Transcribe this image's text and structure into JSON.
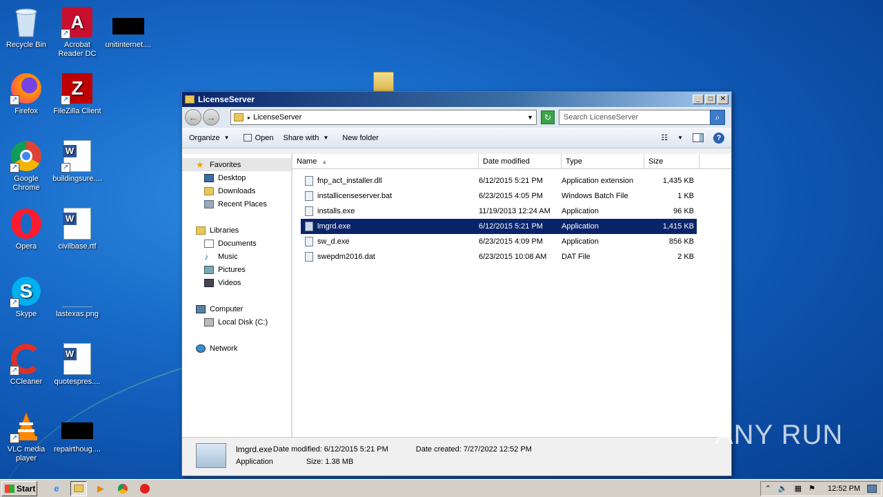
{
  "desktop": {
    "icons": [
      {
        "label": "Recycle Bin",
        "icon": "recycle-bin-icon"
      },
      {
        "label": "Acrobat Reader DC",
        "icon": "acrobat-icon"
      },
      {
        "label": "unitinternet....",
        "icon": "black-thumbnail-icon"
      },
      {
        "label": "Firefox",
        "icon": "firefox-icon"
      },
      {
        "label": "FileZilla Client",
        "icon": "filezilla-icon"
      },
      {
        "label": "Google Chrome",
        "icon": "chrome-icon"
      },
      {
        "label": "buildingsure....",
        "icon": "word-doc-icon"
      },
      {
        "label": "Opera",
        "icon": "opera-icon"
      },
      {
        "label": "civilbase.rtf",
        "icon": "word-doc-icon"
      },
      {
        "label": "Skype",
        "icon": "skype-icon"
      },
      {
        "label": "lastexas.png",
        "icon": "image-icon"
      },
      {
        "label": "CCleaner",
        "icon": "ccleaner-icon"
      },
      {
        "label": "quotespres....",
        "icon": "word-doc-icon"
      },
      {
        "label": "VLC media player",
        "icon": "vlc-icon"
      },
      {
        "label": "repairthoug....",
        "icon": "black-thumbnail-icon"
      }
    ]
  },
  "window": {
    "title": "LicenseServer",
    "address": "LicenseServer",
    "search_placeholder": "Search LicenseServer",
    "toolbar": {
      "organize": "Organize",
      "open": "Open",
      "share_with": "Share with",
      "new_folder": "New folder"
    },
    "nav": {
      "favorites": "Favorites",
      "desktop": "Desktop",
      "downloads": "Downloads",
      "recent_places": "Recent Places",
      "libraries": "Libraries",
      "documents": "Documents",
      "music": "Music",
      "pictures": "Pictures",
      "videos": "Videos",
      "computer": "Computer",
      "local_disk": "Local Disk (C:)",
      "network": "Network"
    },
    "columns": {
      "name": "Name",
      "date_modified": "Date modified",
      "type": "Type",
      "size": "Size"
    },
    "files": [
      {
        "name": "fnp_act_installer.dll",
        "date": "6/12/2015 5:21 PM",
        "type": "Application extension",
        "size": "1,435 KB"
      },
      {
        "name": "installicenseserver.bat",
        "date": "6/23/2015 4:05 PM",
        "type": "Windows Batch File",
        "size": "1 KB"
      },
      {
        "name": "installs.exe",
        "date": "11/19/2013 12:24 AM",
        "type": "Application",
        "size": "96 KB"
      },
      {
        "name": "lmgrd.exe",
        "date": "6/12/2015 5:21 PM",
        "type": "Application",
        "size": "1,415 KB"
      },
      {
        "name": "sw_d.exe",
        "date": "6/23/2015 4:09 PM",
        "type": "Application",
        "size": "856 KB"
      },
      {
        "name": "swepdm2016.dat",
        "date": "6/23/2015 10:08 AM",
        "type": "DAT File",
        "size": "2 KB"
      }
    ],
    "selected_index": 3,
    "details": {
      "name": "lmgrd.exe",
      "type": "Application",
      "date_modified": "Date modified: 6/12/2015 5:21 PM",
      "size": "Size: 1.38 MB",
      "date_created": "Date created: 7/27/2022 12:52 PM"
    }
  },
  "taskbar": {
    "start": "Start",
    "clock": "12:52 PM"
  },
  "watermark": "ANY RUN",
  "colors": {
    "selection": "#0a246a",
    "titlebar": "#0a246a",
    "desktop": "#1769c8"
  }
}
